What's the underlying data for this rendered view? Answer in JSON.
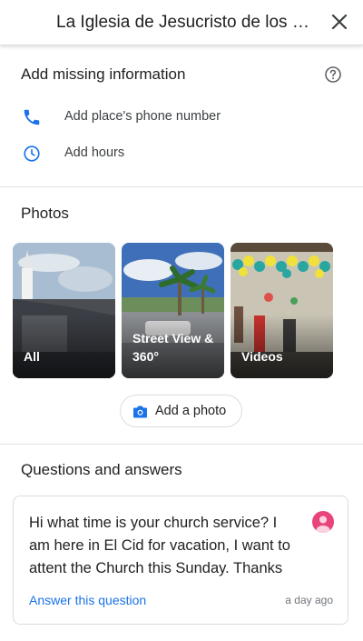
{
  "header": {
    "title": "La Iglesia de Jesucristo de los Santos de los Últimos Días"
  },
  "missing_info": {
    "title": "Add missing information",
    "rows": [
      {
        "label": "Add place's phone number",
        "icon": "phone-icon"
      },
      {
        "label": "Add hours",
        "icon": "clock-icon"
      }
    ]
  },
  "photos": {
    "title": "Photos",
    "cards": [
      {
        "label": "All"
      },
      {
        "label": "Street View & 360°"
      },
      {
        "label": "Videos"
      }
    ],
    "add_photo_label": "Add a photo"
  },
  "qa": {
    "title": "Questions and answers",
    "question": "Hi what time is your church service? I am here in El Cid for vacation, I want to attent the Church this Sunday. Thanks",
    "answer_link": "Answer this question",
    "time": "a day ago"
  },
  "colors": {
    "accent": "#1a73e8",
    "avatar": "#e8437a"
  }
}
